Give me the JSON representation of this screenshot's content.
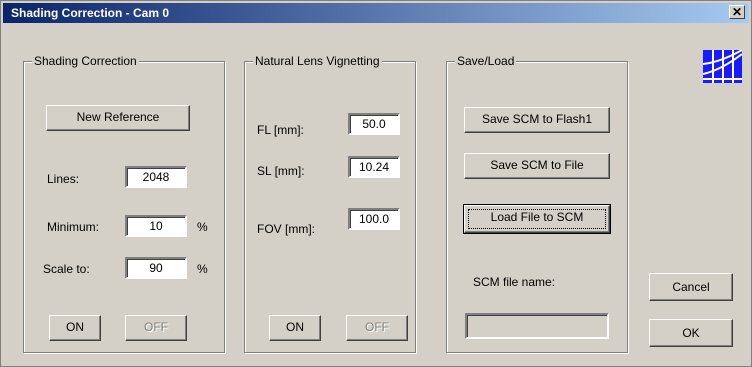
{
  "window": {
    "title": "Shading Correction - Cam 0",
    "close_glyph": "✕"
  },
  "shading": {
    "group_label": "Shading Correction",
    "new_reference_label": "New Reference",
    "lines_label": "Lines:",
    "lines_value": "2048",
    "minimum_label": "Minimum:",
    "minimum_value": "10",
    "minimum_unit": "%",
    "scale_label": "Scale to:",
    "scale_value": "90",
    "scale_unit": "%",
    "on_label": "ON",
    "off_label": "OFF"
  },
  "vignetting": {
    "group_label": "Natural Lens Vignetting",
    "fl_label": "FL [mm]:",
    "fl_value": "50.0",
    "sl_label": "SL [mm]:",
    "sl_value": "10.24",
    "fov_label": "FOV [mm]:",
    "fov_value": "100.0",
    "on_label": "ON",
    "off_label": "OFF"
  },
  "saveload": {
    "group_label": "Save/Load",
    "save_flash_label": "Save SCM to Flash1",
    "save_file_label": "Save SCM to File",
    "load_file_label": "Load File to SCM",
    "file_name_label": "SCM file name:",
    "file_name_value": ""
  },
  "dialog": {
    "cancel_label": "Cancel",
    "ok_label": "OK"
  },
  "logo": {
    "icon": "app-logo-icon",
    "color": "#1a1aff"
  }
}
